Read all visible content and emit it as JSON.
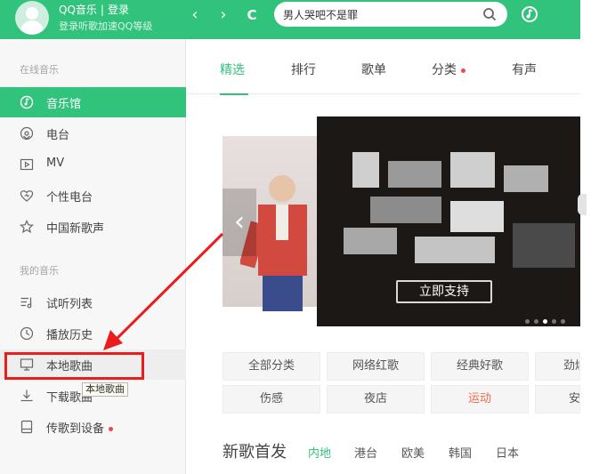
{
  "header": {
    "app_name": "QQ音乐",
    "separator": "|",
    "login_label": "登录",
    "login_hint": "登录听歌加速QQ等级",
    "back_glyph": "‹",
    "forward_glyph": "›",
    "refresh_glyph": "C",
    "search": {
      "value": "男人哭吧不是罪",
      "placeholder": ""
    }
  },
  "sidebar": {
    "online_title": "在线音乐",
    "online_items": [
      {
        "label": "音乐馆",
        "icon": "music-hall-icon"
      },
      {
        "label": "电台",
        "icon": "radio-icon"
      },
      {
        "label": "MV",
        "icon": "mv-icon"
      },
      {
        "label": "个性电台",
        "icon": "heart-icon"
      },
      {
        "label": "中国新歌声",
        "icon": "star-icon"
      }
    ],
    "my_title": "我的音乐",
    "my_items": [
      {
        "label": "试听列表",
        "icon": "playlist-icon"
      },
      {
        "label": "播放历史",
        "icon": "history-icon"
      },
      {
        "label": "本地歌曲",
        "icon": "monitor-icon"
      },
      {
        "label": "下载歌曲",
        "icon": "download-icon"
      },
      {
        "label": "传歌到设备",
        "icon": "device-icon"
      }
    ],
    "tooltip": "本地歌曲"
  },
  "tabs": [
    "精选",
    "排行",
    "歌单",
    "分类",
    "有声"
  ],
  "banner": {
    "button_label": "立即支持",
    "prev_glyph": "‹"
  },
  "categories": {
    "row1": [
      "全部分类",
      "网络红歌",
      "经典好歌",
      "劲爆"
    ],
    "row2": [
      "伤感",
      "夜店",
      "运动",
      "安"
    ]
  },
  "new_songs": {
    "title": "新歌首发",
    "regions": [
      "内地",
      "港台",
      "欧美",
      "韩国",
      "日本"
    ]
  },
  "colors": {
    "brand": "#31c27c",
    "annotation": "#ea1c1c",
    "hot": "#f06b4a"
  }
}
